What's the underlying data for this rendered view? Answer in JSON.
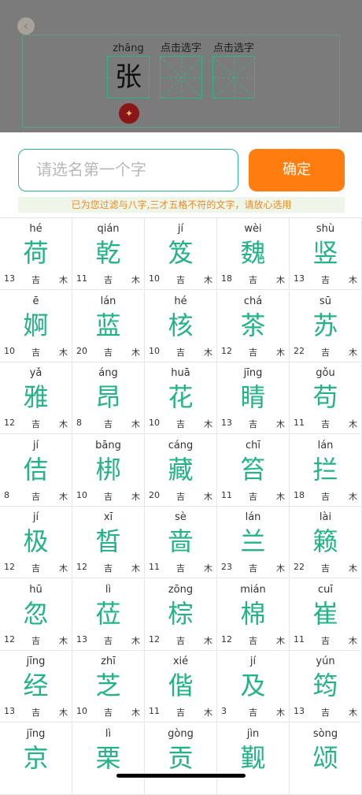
{
  "header": {
    "cells": [
      {
        "pinyin": "zhāng",
        "char": "张"
      },
      {
        "pinyin": "点击选字",
        "char": ""
      },
      {
        "pinyin": "点击选字",
        "char": ""
      }
    ]
  },
  "search": {
    "placeholder": "请选名第一个字"
  },
  "confirm_label": "确定",
  "notice": "已为您过滤与八字,三才五格不符的文字，请放心选用",
  "characters": [
    {
      "pinyin": "hé",
      "char": "荷",
      "strokes": "13",
      "luck": "吉",
      "element": "木"
    },
    {
      "pinyin": "qián",
      "char": "乾",
      "strokes": "11",
      "luck": "吉",
      "element": "木"
    },
    {
      "pinyin": "jí",
      "char": "笈",
      "strokes": "10",
      "luck": "吉",
      "element": "木"
    },
    {
      "pinyin": "wèi",
      "char": "魏",
      "strokes": "18",
      "luck": "吉",
      "element": "木"
    },
    {
      "pinyin": "shù",
      "char": "竖",
      "strokes": "13",
      "luck": "吉",
      "element": "木"
    },
    {
      "pinyin": "ē",
      "char": "婀",
      "strokes": "10",
      "luck": "吉",
      "element": "木"
    },
    {
      "pinyin": "lán",
      "char": "蓝",
      "strokes": "20",
      "luck": "吉",
      "element": "木"
    },
    {
      "pinyin": "hé",
      "char": "核",
      "strokes": "10",
      "luck": "吉",
      "element": "木"
    },
    {
      "pinyin": "chá",
      "char": "茶",
      "strokes": "12",
      "luck": "吉",
      "element": "木"
    },
    {
      "pinyin": "sū",
      "char": "苏",
      "strokes": "22",
      "luck": "吉",
      "element": "木"
    },
    {
      "pinyin": "yǎ",
      "char": "雅",
      "strokes": "12",
      "luck": "吉",
      "element": "木"
    },
    {
      "pinyin": "áng",
      "char": "昂",
      "strokes": "8",
      "luck": "吉",
      "element": "木"
    },
    {
      "pinyin": "huā",
      "char": "花",
      "strokes": "10",
      "luck": "吉",
      "element": "木"
    },
    {
      "pinyin": "jīng",
      "char": "睛",
      "strokes": "13",
      "luck": "吉",
      "element": "木"
    },
    {
      "pinyin": "gǒu",
      "char": "苟",
      "strokes": "11",
      "luck": "吉",
      "element": "木"
    },
    {
      "pinyin": "jí",
      "char": "佶",
      "strokes": "8",
      "luck": "吉",
      "element": "木"
    },
    {
      "pinyin": "bāng",
      "char": "梆",
      "strokes": "10",
      "luck": "吉",
      "element": "木"
    },
    {
      "pinyin": "cáng",
      "char": "藏",
      "strokes": "20",
      "luck": "吉",
      "element": "木"
    },
    {
      "pinyin": "chī",
      "char": "笞",
      "strokes": "11",
      "luck": "吉",
      "element": "木"
    },
    {
      "pinyin": "lán",
      "char": "拦",
      "strokes": "18",
      "luck": "吉",
      "element": "木"
    },
    {
      "pinyin": "jí",
      "char": "极",
      "strokes": "12",
      "luck": "吉",
      "element": "木"
    },
    {
      "pinyin": "xī",
      "char": "晳",
      "strokes": "12",
      "luck": "吉",
      "element": "木"
    },
    {
      "pinyin": "sè",
      "char": "啬",
      "strokes": "11",
      "luck": "吉",
      "element": "木"
    },
    {
      "pinyin": "lán",
      "char": "兰",
      "strokes": "23",
      "luck": "吉",
      "element": "木"
    },
    {
      "pinyin": "lài",
      "char": "籁",
      "strokes": "22",
      "luck": "吉",
      "element": "木"
    },
    {
      "pinyin": "hū",
      "char": "忽",
      "strokes": "12",
      "luck": "吉",
      "element": "木"
    },
    {
      "pinyin": "lì",
      "char": "莅",
      "strokes": "13",
      "luck": "吉",
      "element": "木"
    },
    {
      "pinyin": "zōng",
      "char": "棕",
      "strokes": "12",
      "luck": "吉",
      "element": "木"
    },
    {
      "pinyin": "mián",
      "char": "棉",
      "strokes": "12",
      "luck": "吉",
      "element": "木"
    },
    {
      "pinyin": "cuī",
      "char": "崔",
      "strokes": "11",
      "luck": "吉",
      "element": "木"
    },
    {
      "pinyin": "jīng",
      "char": "经",
      "strokes": "13",
      "luck": "吉",
      "element": "木"
    },
    {
      "pinyin": "zhī",
      "char": "芝",
      "strokes": "10",
      "luck": "吉",
      "element": "木"
    },
    {
      "pinyin": "xié",
      "char": "偕",
      "strokes": "11",
      "luck": "吉",
      "element": "木"
    },
    {
      "pinyin": "jí",
      "char": "及",
      "strokes": "3",
      "luck": "吉",
      "element": "木"
    },
    {
      "pinyin": "yún",
      "char": "筠",
      "strokes": "13",
      "luck": "吉",
      "element": "木"
    },
    {
      "pinyin": "jīng",
      "char": "京",
      "strokes": "",
      "luck": "",
      "element": ""
    },
    {
      "pinyin": "lì",
      "char": "栗",
      "strokes": "",
      "luck": "",
      "element": ""
    },
    {
      "pinyin": "gòng",
      "char": "贡",
      "strokes": "",
      "luck": "",
      "element": ""
    },
    {
      "pinyin": "jìn",
      "char": "觐",
      "strokes": "",
      "luck": "",
      "element": ""
    },
    {
      "pinyin": "sòng",
      "char": "颂",
      "strokes": "",
      "luck": "",
      "element": ""
    }
  ]
}
